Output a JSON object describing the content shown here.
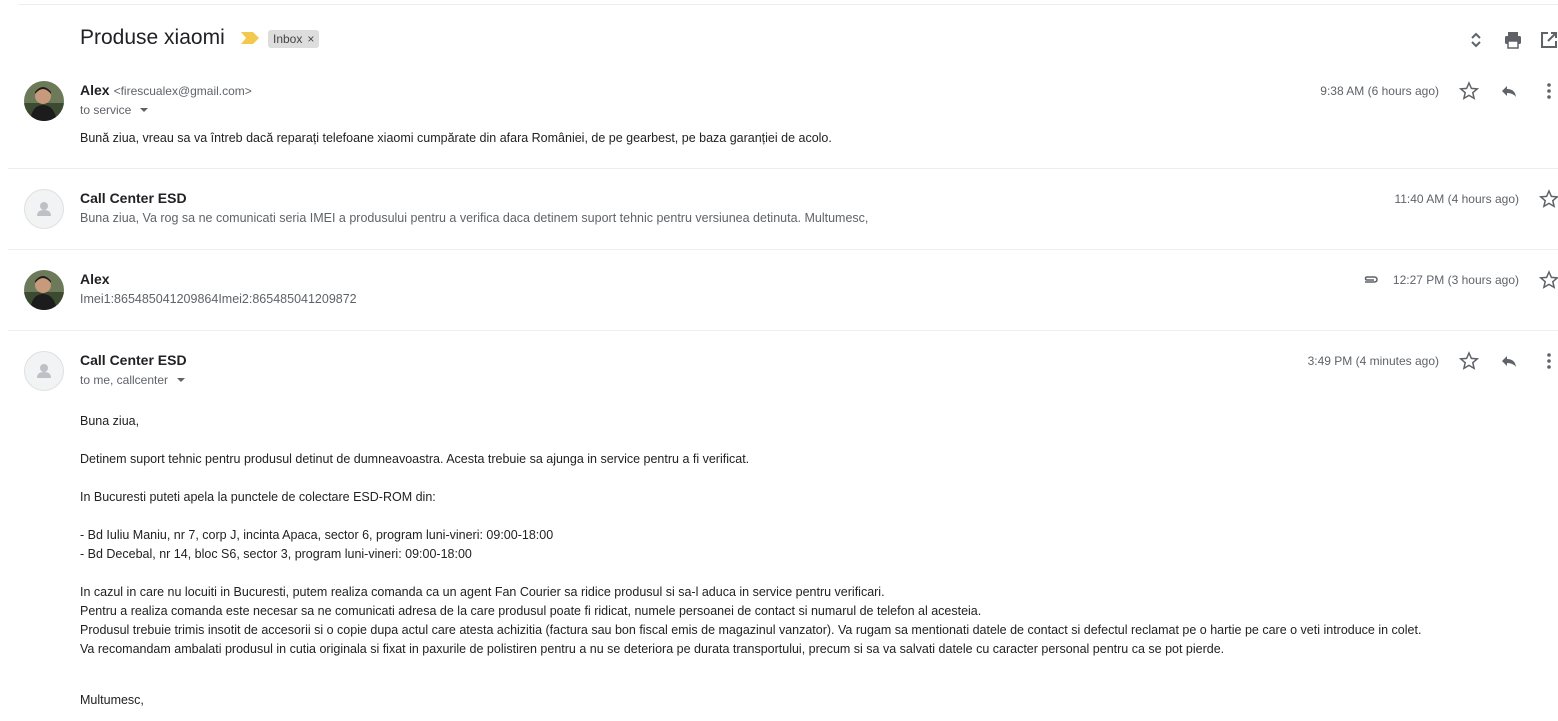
{
  "subject": "Produse xiaomi",
  "label": "Inbox",
  "label_close": "×",
  "colors": {
    "important": "#f2c94c",
    "chip_bg": "#dddddd",
    "separator": "#eceff1"
  },
  "messages": [
    {
      "sender": "Alex",
      "email": "<firescualex@gmail.com>",
      "recipients": "to service",
      "time": "9:38 AM (6 hours ago)",
      "body": "Bună ziua, vreau sa va întreb dacă reparați telefoane xiaomi cumpărate din afara României, de pe gearbest, pe baza garanției de acolo."
    },
    {
      "sender": "Call Center ESD",
      "time": "11:40 AM (4 hours ago)",
      "snippet": "Buna ziua, Va rog sa ne comunicati seria IMEI a produsului pentru a verifica daca detinem suport tehnic pentru versiunea detinuta. Multumesc,"
    },
    {
      "sender": "Alex",
      "time": "12:27 PM (3 hours ago)",
      "snippet": "Imei1:865485041209864Imei2:865485041209872"
    },
    {
      "sender": "Call Center ESD",
      "recipients": "to me, callcenter",
      "time": "3:49 PM (4 minutes ago)",
      "body_lines": [
        "Buna ziua,",
        "Detinem suport tehnic pentru produsul detinut de dumneavoastra. Acesta trebuie sa ajunga in service pentru a fi verificat.",
        "In Bucuresti puteti apela la punctele de colectare ESD-ROM din:",
        "- Bd Iuliu Maniu, nr 7, corp J, incinta Apaca, sector 6, program luni-vineri: 09:00-18:00",
        "- Bd Decebal, nr 14, bloc S6, sector 3, program luni-vineri: 09:00-18:00",
        "In cazul in care nu locuiti in Bucuresti, putem realiza comanda ca un agent Fan Courier sa ridice produsul si sa-l aduca in service pentru verificari.",
        "Pentru a realiza comanda este necesar sa ne comunicati adresa de la care produsul poate fi ridicat, numele persoanei de contact si numarul de telefon al acesteia.",
        "Produsul trebuie trimis insotit de accesorii si o copie dupa actul care atesta achizitia (factura sau bon fiscal emis de magazinul vanzator). Va rugam sa mentionati datele de contact si defectul reclamat pe o hartie pe care o veti introduce in colet.",
        "Va recomandam ambalati produsul in cutia originala si fixat in paxurile de polistiren pentru a nu se deteriora pe durata transportului, precum si sa va salvati datele cu caracter personal pentru ca se pot pierde.",
        "Multumesc,"
      ]
    }
  ],
  "icons": [
    "expand-collapse-icon",
    "print-icon",
    "open-in-new-window-icon",
    "star-icon",
    "reply-icon",
    "more-options-icon",
    "attachment-icon",
    "default-avatar-icon"
  ]
}
